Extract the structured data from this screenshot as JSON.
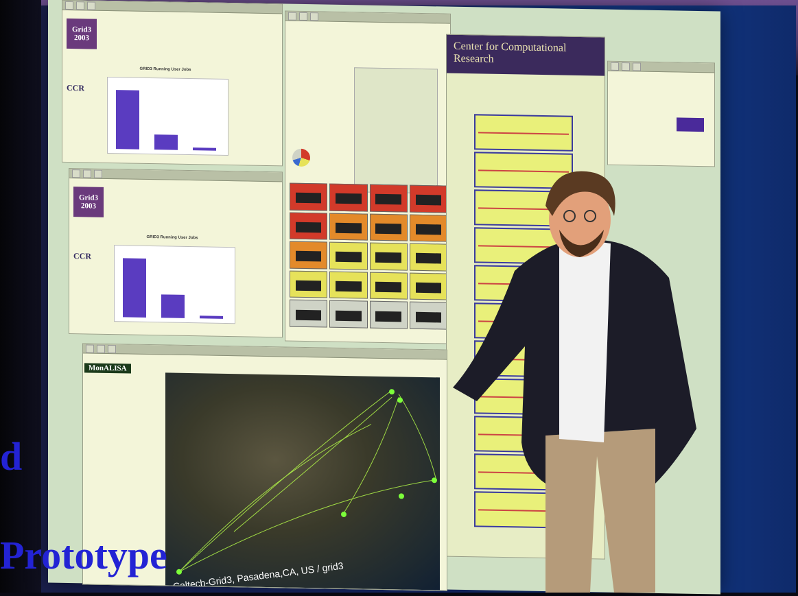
{
  "overlay": {
    "letter_d": "d",
    "prototype": "Prototype"
  },
  "screen": {
    "grid_logo": "Grid3 2003",
    "ccr_logo": "CCR",
    "chart_title": "GRID3 Running User Jobs",
    "monalisa_title": "MonALISA",
    "ccr_header": "Center for Computational Research",
    "map_caption": "Caltech-Grid3, Pasadena,CA, US / grid3"
  },
  "colors": {
    "overlay_text": "#2323d4",
    "bars": "#5a3cc0",
    "tile_red": "#d23a2a",
    "tile_orange": "#e38a2a",
    "tile_yellow": "#e6e25a",
    "tile_grey": "#cfd3c6"
  }
}
